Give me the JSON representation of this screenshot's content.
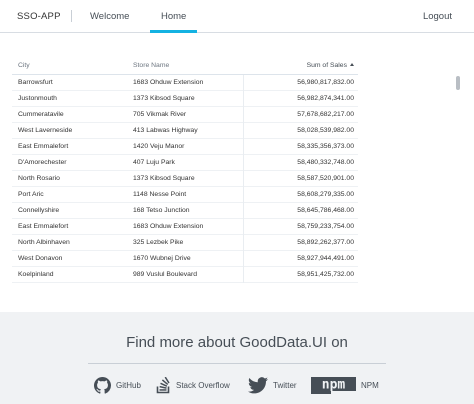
{
  "header": {
    "brand": "SSO-APP",
    "nav": [
      {
        "label": "Welcome"
      },
      {
        "label": "Home"
      }
    ],
    "logout": "Logout",
    "accent_color": "#14b2e2"
  },
  "table": {
    "columns": {
      "city": "City",
      "store": "Store Name",
      "sales": "Sum of Sales"
    },
    "rows": [
      {
        "city": "Barrowsfurt",
        "store": "1683 Ohduw Extension",
        "sales": "56,980,817,832.00"
      },
      {
        "city": "Justonmouth",
        "store": "1373 Kibsod Square",
        "sales": "56,982,874,341.00"
      },
      {
        "city": "Cummeratavile",
        "store": "705 Vikmak River",
        "sales": "57,678,682,217.00"
      },
      {
        "city": "West Laverneside",
        "store": "413 Labwas Highway",
        "sales": "58,028,539,982.00"
      },
      {
        "city": "East Emmalefort",
        "store": "1420 Veju Manor",
        "sales": "58,335,356,373.00"
      },
      {
        "city": "D'Amorechester",
        "store": "407 Luju Park",
        "sales": "58,480,332,748.00"
      },
      {
        "city": "North Rosario",
        "store": "1373 Kibsod Square",
        "sales": "58,587,520,901.00"
      },
      {
        "city": "Port Aric",
        "store": "1148 Nesse Point",
        "sales": "58,608,279,335.00"
      },
      {
        "city": "Connellyshire",
        "store": "168 Tetso Junction",
        "sales": "58,645,786,468.00"
      },
      {
        "city": "East Emmalefort",
        "store": "1683 Ohduw Extension",
        "sales": "58,759,233,754.00"
      },
      {
        "city": "North Albinhaven",
        "store": "325 Lezbek Pike",
        "sales": "58,892,262,377.00"
      },
      {
        "city": "West Donavon",
        "store": "1670 Wubnej Drive",
        "sales": "58,927,944,491.00"
      },
      {
        "city": "Koelpinland",
        "store": "989 Vuslul Boulevard",
        "sales": "58,951,425,732.00"
      }
    ]
  },
  "footer": {
    "title": "Find more about GoodData.UI on",
    "links": [
      {
        "label": "GitHub",
        "icon": "github-icon"
      },
      {
        "label": "Stack Overflow",
        "icon": "stack-overflow-icon"
      },
      {
        "label": "Twitter",
        "icon": "twitter-icon"
      },
      {
        "label": "NPM",
        "icon": "npm-icon",
        "logo_text": "npm"
      }
    ]
  }
}
